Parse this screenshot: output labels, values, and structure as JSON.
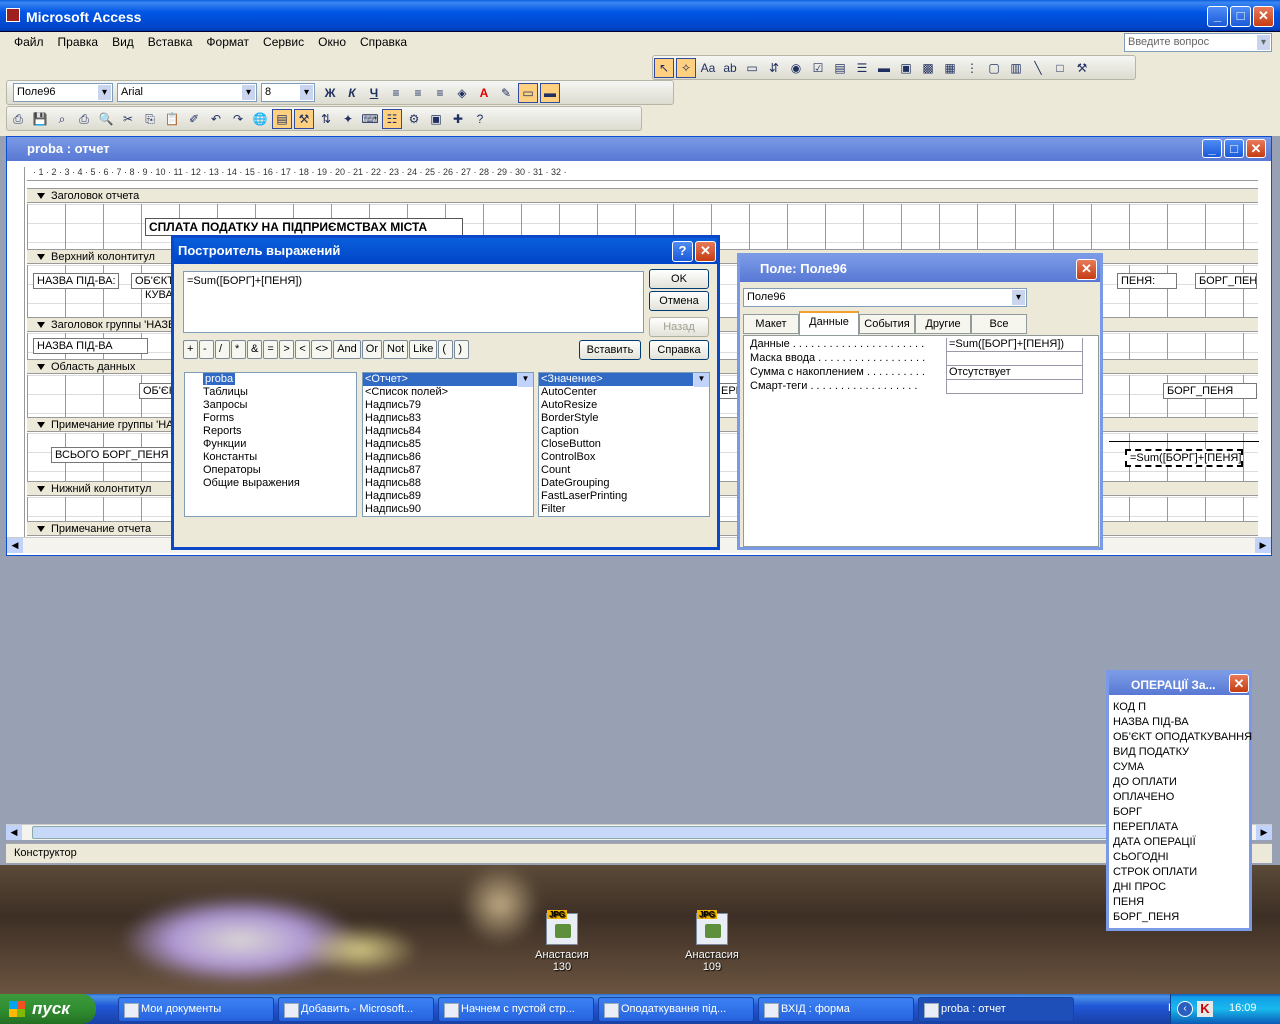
{
  "app": {
    "title": "Microsoft Access",
    "help_placeholder": "Введите вопрос"
  },
  "menu": [
    "Файл",
    "Правка",
    "Вид",
    "Вставка",
    "Формат",
    "Сервис",
    "Окно",
    "Справка"
  ],
  "format_toolbar": {
    "object": "Поле96",
    "font": "Arial",
    "size": "8",
    "bold": "Ж",
    "italic": "К",
    "underline": "Ч"
  },
  "report": {
    "title": "proba : отчет",
    "ruler": "· 1 · 2 · 3 · 4 · 5 · 6 · 7 · 8 · 9 · 10 · 11 · 12 · 13 · 14 · 15 · 16 · 17 · 18 · 19 · 20 · 21 · 22 · 23 · 24 · 25 · 26 · 27 · 28 · 29 · 30 · 31 · 32 ·",
    "sections": {
      "report_header": "Заголовок отчета",
      "page_header": "Верхний колонтитул",
      "group_header": "Заголовок группы 'НАЗВА",
      "detail": "Область данных",
      "group_footer": "Примечание группы 'НАЗ",
      "page_footer": "Нижний колонтитул",
      "report_footer": "Примечание отчета"
    },
    "controls": {
      "heading": "СПЛАТА ПОДАТКУ НА ПІДПРИЄМСТВАХ МІСТА",
      "h_name": "НАЗВА ПІД-ВА:",
      "h_object": "ОБ'ЄКТ",
      "h_object2": "КУВА",
      "h_penya": "ПЕНЯ:",
      "h_borg": "БОРГ_ПЕН",
      "g_name": "НАЗВА ПІД-ВА",
      "d_object": "ОБ'ЄК",
      "d_borg": "БОРГ_ПЕНЯ",
      "f_total": "ВСЬОГО БОРГ_ПЕНЯ П",
      "f_sum": "=Sum([БОРГ]+[ПЕНЯ])",
      "d_pere": "ЕРЕ"
    }
  },
  "builder": {
    "title": "Построитель выражений",
    "expression": "=Sum([БОРГ]+[ПЕНЯ])",
    "ok": "OK",
    "cancel": "Отмена",
    "back": "Назад",
    "insert": "Вставить",
    "help": "Справка",
    "operators": [
      "+",
      "-",
      "/",
      "*",
      "&",
      "=",
      ">",
      "<",
      "<>",
      "And",
      "Or",
      "Not",
      "Like",
      "(",
      ")"
    ],
    "folders": [
      "proba",
      "Таблицы",
      "Запросы",
      "Forms",
      "Reports",
      "Функции",
      "Константы",
      "Операторы",
      "Общие выражения"
    ],
    "middle": [
      "<Отчет>",
      "<Список полей>",
      "Надпись79",
      "Надпись83",
      "Надпись84",
      "Надпись85",
      "Надпись86",
      "Надпись87",
      "Надпись88",
      "Надпись89",
      "Надпись90"
    ],
    "right": [
      "<Значение>",
      "AutoCenter",
      "AutoResize",
      "BorderStyle",
      "Caption",
      "CloseButton",
      "ControlBox",
      "Count",
      "DateGrouping",
      "FastLaserPrinting",
      "Filter"
    ]
  },
  "props": {
    "title": "Поле: Поле96",
    "selected": "Поле96",
    "tabs": [
      "Макет",
      "Данные",
      "События",
      "Другие",
      "Все"
    ],
    "rows": [
      {
        "k": "Данные . . . . . . . . . . . . . . . . . . . . . .",
        "v": "=Sum([БОРГ]+[ПЕНЯ])"
      },
      {
        "k": "Маска ввода . . . . . . . . . . . . . . . . . .",
        "v": ""
      },
      {
        "k": "Сумма с накоплением . . . . . . . . . .",
        "v": "Отсутствует"
      },
      {
        "k": "Смарт-теги . . . . . . . . . . . . . . . . . .",
        "v": ""
      }
    ]
  },
  "fieldlist": {
    "title": "ОПЕРАЦІЇ За...",
    "items": [
      "КОД П",
      "НАЗВА ПІД-ВА",
      "ОБ'ЄКТ ОПОДАТКУВАННЯ",
      "ВИД ПОДАТКУ",
      "СУМА",
      "ДО ОПЛАТИ",
      "ОПЛАЧЕНО",
      "БОРГ",
      "ПЕРЕПЛАТА",
      "ДАТА ОПЕРАЦІЇ",
      "СЬОГОДНІ",
      "СТРОК ОПЛАТИ",
      "ДНІ ПРОС",
      "ПЕНЯ",
      "БОРГ_ПЕНЯ"
    ]
  },
  "status": "Конструктор",
  "desktop": [
    {
      "name": "Анастасия",
      "num": "130"
    },
    {
      "name": "Анастасия",
      "num": "109"
    }
  ],
  "taskbar": {
    "start": "пуск",
    "tasks": [
      "Мои документы",
      "Добавить - Microsoft...",
      "Начнем с пустой стр...",
      "Оподаткування під...",
      "ВХІД : форма",
      "proba : отчет"
    ],
    "lang": "EN",
    "time": "16:09"
  }
}
